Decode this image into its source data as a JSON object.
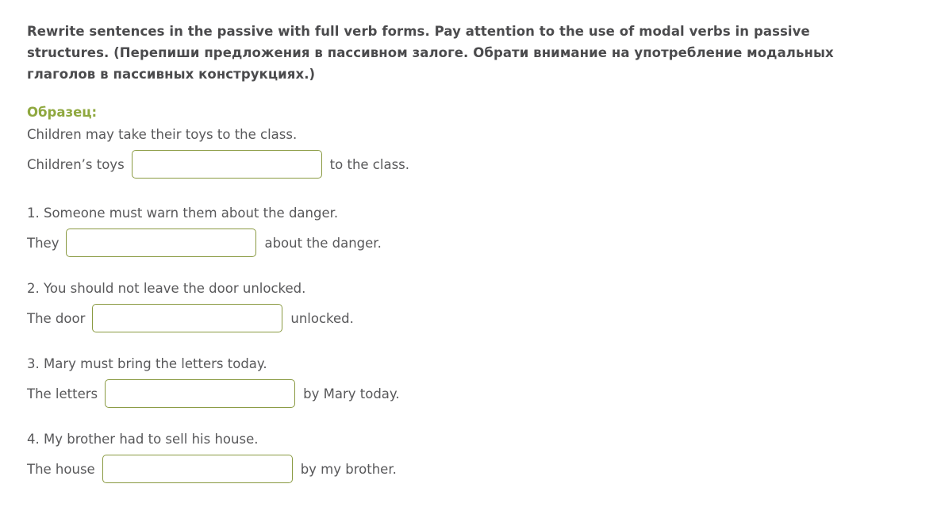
{
  "task": {
    "heading": "Rewrite sentences in the passive with full verb forms. Pay attention to the use of modal verbs in passive structures. (Перепиши предложения в пассивном залоге. Обрати внимание на употребление модальных глаголов в пассивных конструкциях.)"
  },
  "sample": {
    "label": "Образец:",
    "prompt": "Children may take their toys to the class.",
    "answer_before": "Children’s toys",
    "answer_value": "",
    "answer_placeholder": "",
    "answer_after": "to the class."
  },
  "questions": [
    {
      "prompt": "1. Someone must warn them about the danger.",
      "answer_before": "They",
      "answer_value": "",
      "answer_placeholder": "",
      "answer_after": "about the danger."
    },
    {
      "prompt": "2. You should not leave the door unlocked.",
      "answer_before": "The door",
      "answer_value": "",
      "answer_placeholder": "",
      "answer_after": "unlocked."
    },
    {
      "prompt": "3. Mary must bring the letters today.",
      "answer_before": "The letters",
      "answer_value": "",
      "answer_placeholder": "",
      "answer_after": "by Mary today."
    },
    {
      "prompt": "4. My brother had to sell his house.",
      "answer_before": "The house",
      "answer_value": "",
      "answer_placeholder": "",
      "answer_after": "by my brother."
    }
  ],
  "colors": {
    "accent_green": "#8fa83f",
    "input_border": "#8a9a42",
    "heading_text": "#4b4b4d",
    "body_text": "#58585a",
    "background": "#ffffff"
  }
}
